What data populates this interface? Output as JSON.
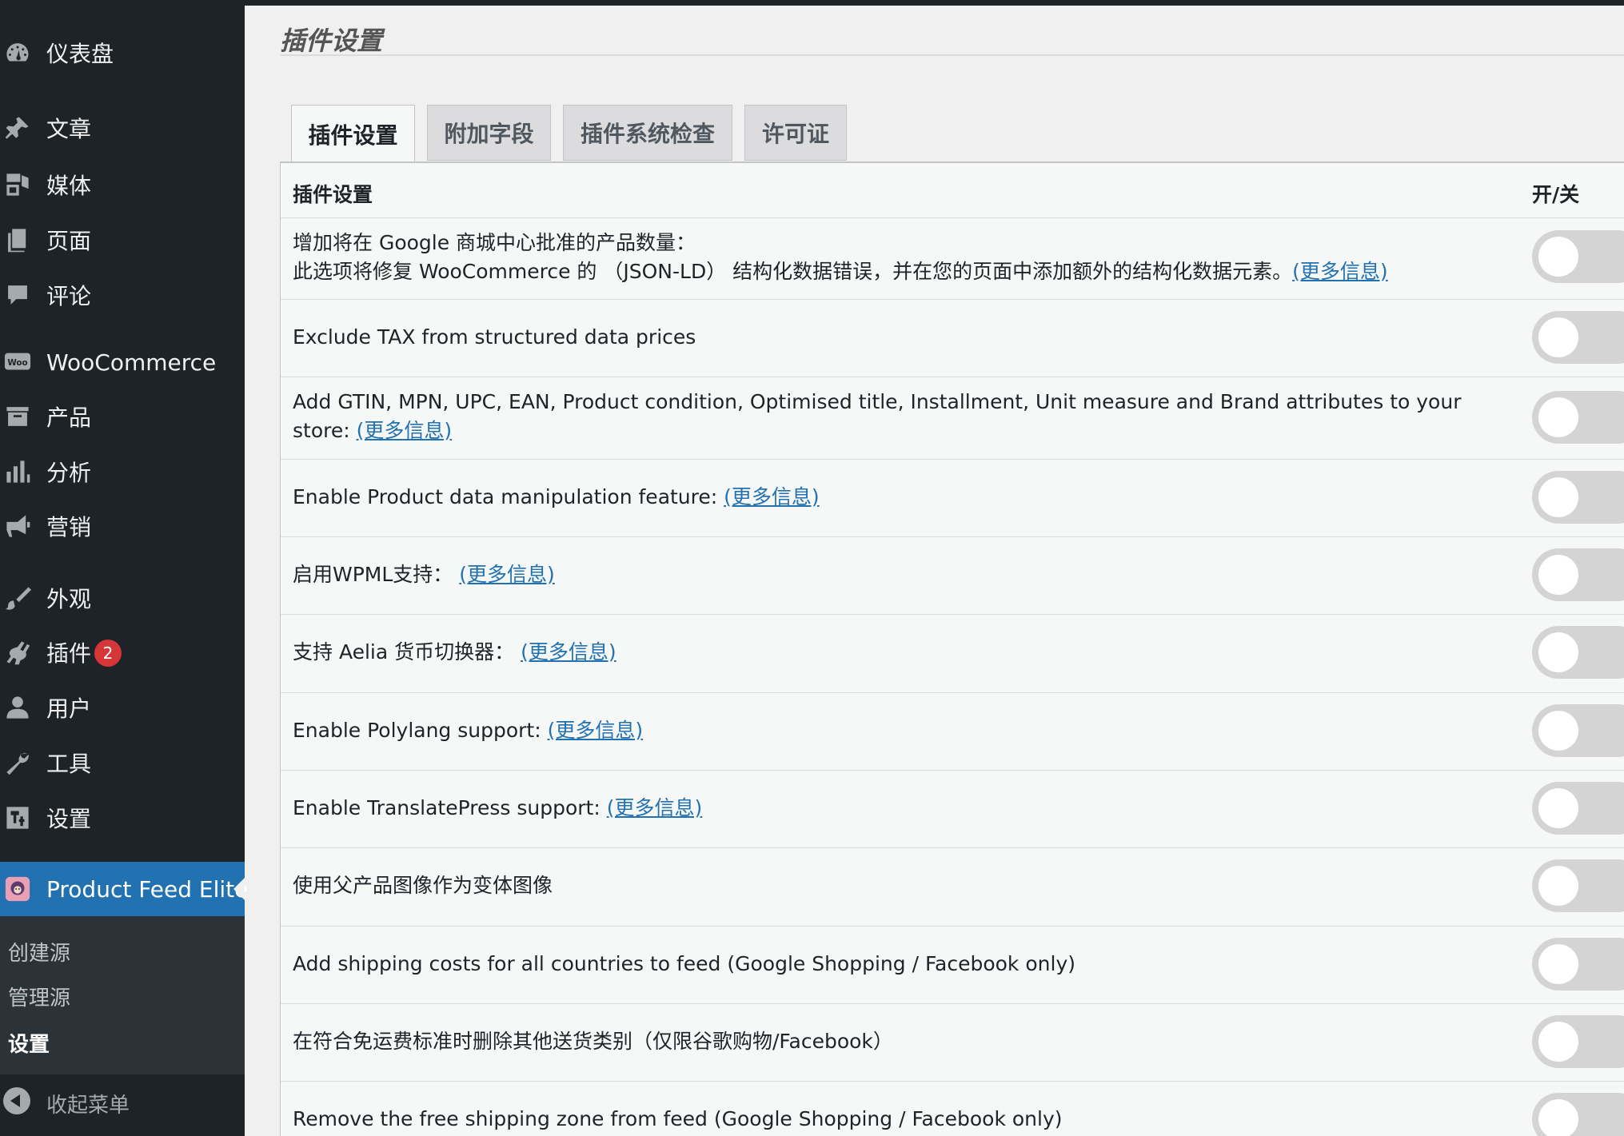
{
  "sidebar": {
    "items": [
      {
        "label": "仪表盘",
        "icon": "dashboard-icon"
      },
      {
        "label": "文章",
        "icon": "pin-icon"
      },
      {
        "label": "媒体",
        "icon": "media-icon"
      },
      {
        "label": "页面",
        "icon": "page-icon"
      },
      {
        "label": "评论",
        "icon": "comment-icon"
      },
      {
        "label": "WooCommerce",
        "icon": "woo-icon"
      },
      {
        "label": "产品",
        "icon": "archive-icon"
      },
      {
        "label": "分析",
        "icon": "chart-bar-icon"
      },
      {
        "label": "营销",
        "icon": "megaphone-icon"
      },
      {
        "label": "外观",
        "icon": "brush-icon"
      },
      {
        "label": "插件",
        "icon": "plugin-icon",
        "badge": "2"
      },
      {
        "label": "用户",
        "icon": "user-icon"
      },
      {
        "label": "工具",
        "icon": "wrench-icon"
      },
      {
        "label": "设置",
        "icon": "settings-icon"
      }
    ],
    "current": {
      "label": "Product Feed Elite",
      "icon": "product-feed-elite-logo-icon"
    },
    "submenu": [
      "创建源",
      "管理源",
      "设置"
    ],
    "collapse": "收起菜单"
  },
  "page": {
    "title": "插件设置"
  },
  "tabs": [
    "插件设置",
    "附加字段",
    "插件系统检查",
    "许可证"
  ],
  "table": {
    "header_left": "插件设置",
    "header_right": "开/关",
    "rows": [
      {
        "line1": "增加将在 Google 商城中心批准的产品数量：",
        "text": "此选项将修复 WooCommerce 的 （JSON-LD） 结构化数据错误，并在您的页面中添加额外的结构化数据元素。",
        "link": "(更多信息)",
        "enabled": false
      },
      {
        "text": "Exclude TAX from structured data prices",
        "enabled": false
      },
      {
        "text": "Add GTIN, MPN, UPC, EAN, Product condition, Optimised title, Installment, Unit measure and Brand attributes to your store: ",
        "link": "(更多信息)",
        "enabled": false
      },
      {
        "text": "Enable Product data manipulation feature: ",
        "link": "(更多信息)",
        "enabled": false
      },
      {
        "text": "启用WPML支持： ",
        "link": "(更多信息)",
        "enabled": false
      },
      {
        "text": "支持 Aelia 货币切换器： ",
        "link": "(更多信息)",
        "enabled": false
      },
      {
        "text": "Enable Polylang support: ",
        "link": "(更多信息)",
        "enabled": false
      },
      {
        "text": "Enable TranslatePress support: ",
        "link": "(更多信息)",
        "enabled": false
      },
      {
        "text": "使用父产品图像作为变体图像",
        "enabled": false
      },
      {
        "text": "Add shipping costs for all countries to feed (Google Shopping / Facebook only)",
        "enabled": false
      },
      {
        "text": "在符合免运费标准时删除其他送货类别（仅限谷歌购物/Facebook）",
        "enabled": false
      },
      {
        "text": "Remove the free shipping zone from feed (Google Shopping / Facebook only)",
        "enabled": false
      }
    ]
  },
  "colors": {
    "sidebar_bg": "#1d2327",
    "accent": "#2271b1",
    "badge": "#d63638",
    "link": "#2271b1"
  }
}
